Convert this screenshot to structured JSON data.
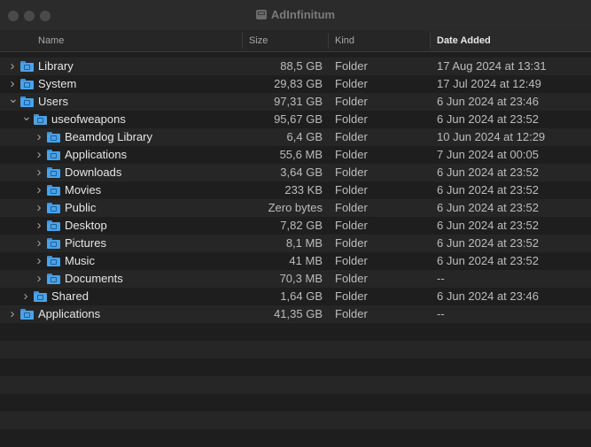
{
  "window": {
    "title": "AdInfinitum",
    "title_icon": "disk-icon"
  },
  "columns": {
    "name": "Name",
    "size": "Size",
    "kind": "Kind",
    "date_added": "Date Added",
    "sorted_by": "date_added"
  },
  "colors": {
    "folder": "#4aa3ea",
    "background": "#1e1e1e",
    "stripe": "#262626"
  },
  "rows": [
    {
      "name": "Library",
      "size": "88,5 GB",
      "kind": "Folder",
      "date": "17 Aug 2024 at 13:31",
      "depth": 0,
      "expanded": false
    },
    {
      "name": "System",
      "size": "29,83 GB",
      "kind": "Folder",
      "date": "17 Jul 2024 at 12:49",
      "depth": 0,
      "expanded": false
    },
    {
      "name": "Users",
      "size": "97,31 GB",
      "kind": "Folder",
      "date": "6 Jun 2024 at 23:46",
      "depth": 0,
      "expanded": true
    },
    {
      "name": "useofweapons",
      "size": "95,67 GB",
      "kind": "Folder",
      "date": "6 Jun 2024 at 23:52",
      "depth": 1,
      "expanded": true
    },
    {
      "name": "Beamdog Library",
      "size": "6,4 GB",
      "kind": "Folder",
      "date": "10 Jun 2024 at 12:29",
      "depth": 2,
      "expanded": false
    },
    {
      "name": "Applications",
      "size": "55,6 MB",
      "kind": "Folder",
      "date": "7 Jun 2024 at 00:05",
      "depth": 2,
      "expanded": false
    },
    {
      "name": "Downloads",
      "size": "3,64 GB",
      "kind": "Folder",
      "date": "6 Jun 2024 at 23:52",
      "depth": 2,
      "expanded": false
    },
    {
      "name": "Movies",
      "size": "233 KB",
      "kind": "Folder",
      "date": "6 Jun 2024 at 23:52",
      "depth": 2,
      "expanded": false
    },
    {
      "name": "Public",
      "size": "Zero bytes",
      "kind": "Folder",
      "date": "6 Jun 2024 at 23:52",
      "depth": 2,
      "expanded": false
    },
    {
      "name": "Desktop",
      "size": "7,82 GB",
      "kind": "Folder",
      "date": "6 Jun 2024 at 23:52",
      "depth": 2,
      "expanded": false
    },
    {
      "name": "Pictures",
      "size": "8,1 MB",
      "kind": "Folder",
      "date": "6 Jun 2024 at 23:52",
      "depth": 2,
      "expanded": false
    },
    {
      "name": "Music",
      "size": "41 MB",
      "kind": "Folder",
      "date": "6 Jun 2024 at 23:52",
      "depth": 2,
      "expanded": false
    },
    {
      "name": "Documents",
      "size": "70,3 MB",
      "kind": "Folder",
      "date": "--",
      "depth": 2,
      "expanded": false
    },
    {
      "name": "Shared",
      "size": "1,64 GB",
      "kind": "Folder",
      "date": "6 Jun 2024 at 23:46",
      "depth": 1,
      "expanded": false
    },
    {
      "name": "Applications",
      "size": "41,35 GB",
      "kind": "Folder",
      "date": "--",
      "depth": 0,
      "expanded": false
    }
  ]
}
